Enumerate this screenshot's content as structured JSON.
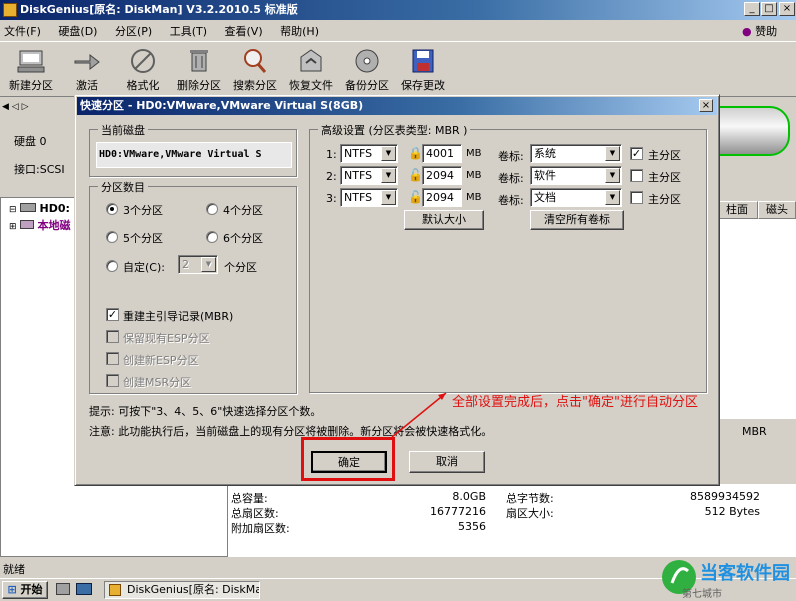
{
  "main_window": {
    "title": "DiskGenius[原名: DiskMan] V3.2.2010.5 标准版",
    "menu": [
      "文件(F)",
      "硬盘(D)",
      "分区(P)",
      "工具(T)",
      "查看(V)",
      "帮助(H)"
    ],
    "donate": "赞助",
    "toolbar": [
      {
        "label": "新建分区",
        "icon": "new-partition-icon"
      },
      {
        "label": "激活",
        "icon": "activate-icon"
      },
      {
        "label": "格式化",
        "icon": "format-icon"
      },
      {
        "label": "删除分区",
        "icon": "delete-partition-icon"
      },
      {
        "label": "搜索分区",
        "icon": "search-partition-icon"
      },
      {
        "label": "恢复文件",
        "icon": "recover-files-icon"
      },
      {
        "label": "备份分区",
        "icon": "backup-partition-icon"
      },
      {
        "label": "保存更改",
        "icon": "save-changes-icon"
      }
    ],
    "disk_label": "硬盘 0",
    "interface_label": "接口:SCSI",
    "tree": [
      "HD0:",
      "本地磁"
    ],
    "columns": [
      "柱面",
      "磁头"
    ],
    "mbr": "MBR",
    "stats": [
      {
        "label": "总容量:",
        "value": "8.0GB"
      },
      {
        "label": "总扇区数:",
        "value": "16777216"
      },
      {
        "label": "附加扇区数:",
        "value": "5356"
      }
    ],
    "stats_right": [
      {
        "label": "总字节数:",
        "value": "8589934592"
      },
      {
        "label": "扇区大小:",
        "value": "512 Bytes"
      }
    ],
    "status": "就绪"
  },
  "dialog": {
    "title": "快速分区 - HD0:VMware,VMware Virtual S(8GB)",
    "current_disk_group": "当前磁盘",
    "current_disk_value": "HD0:VMware,VMware Virtual S",
    "count_group": "分区数目",
    "count_options": [
      "3个分区",
      "4个分区",
      "5个分区",
      "6个分区"
    ],
    "custom_label": "自定(C):",
    "custom_value": "2",
    "custom_unit": "个分区",
    "rebuild_mbr": "重建主引导记录(MBR)",
    "keep_esp": "保留现有ESP分区",
    "create_esp": "创建新ESP分区",
    "create_msr": "创建MSR分区",
    "advanced_group": "高级设置 (分区表类型: MBR )",
    "size_unit": "MB",
    "volume_label": "卷标:",
    "primary_label": "主分区",
    "rows": [
      {
        "index": "1:",
        "fs": "NTFS",
        "size": "4001",
        "volume": "系统",
        "primary": true
      },
      {
        "index": "2:",
        "fs": "NTFS",
        "size": "2094",
        "volume": "软件",
        "primary": false
      },
      {
        "index": "3:",
        "fs": "NTFS",
        "size": "2094",
        "volume": "文档",
        "primary": false
      }
    ],
    "default_size_button": "默认大小",
    "clear_labels_button": "清空所有卷标",
    "hint": "提示: 可按下\"3、4、5、6\"快速选择分区个数。",
    "warning": "注意: 此功能执行后，当前磁盘上的现有分区将被删除。新分区将会被快速格式化。",
    "ok_button": "确定",
    "cancel_button": "取消"
  },
  "annotation": "全部设置完成后，点击\"确定\"进行自动分区",
  "taskbar": {
    "start": "开始",
    "task": "DiskGenius[原名: DiskMa...",
    "watermark": "当客软件园",
    "watermark_sub": "第七城市"
  }
}
